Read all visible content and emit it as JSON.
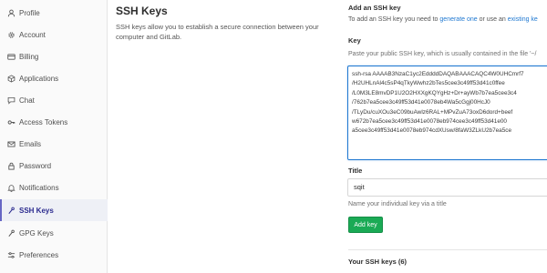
{
  "sidebar": {
    "items": [
      {
        "label": "Profile",
        "icon": "user-icon"
      },
      {
        "label": "Account",
        "icon": "gear-icon"
      },
      {
        "label": "Billing",
        "icon": "credit-card-icon"
      },
      {
        "label": "Applications",
        "icon": "cube-icon"
      },
      {
        "label": "Chat",
        "icon": "comment-icon"
      },
      {
        "label": "Access Tokens",
        "icon": "key-icon"
      },
      {
        "label": "Emails",
        "icon": "envelope-icon"
      },
      {
        "label": "Password",
        "icon": "lock-icon"
      },
      {
        "label": "Notifications",
        "icon": "bell-icon"
      },
      {
        "label": "SSH Keys",
        "icon": "key-icon",
        "active": true
      },
      {
        "label": "GPG Keys",
        "icon": "key-icon"
      },
      {
        "label": "Preferences",
        "icon": "sliders-icon"
      }
    ]
  },
  "intro": {
    "title": "SSH Keys",
    "description": "SSH keys allow you to establish a secure connection between your computer and GitLab."
  },
  "form": {
    "heading": "Add an SSH key",
    "hint_prefix": "To add an SSH key you need to ",
    "hint_link1": "generate one",
    "hint_middle": " or use an ",
    "hint_link2": "existing ke",
    "key_label": "Key",
    "key_hint": "Paste your public SSH key, which is usually contained in the file '~/",
    "key_value_lines": [
      "ssh-rsa AAAAB3NzaC1yc2EddddDAQABAAACAQC4W0UHCmrf7",
      "/H2UHLnAl4c5sP4qTkyWwhz2bTes5cee3c49ff53d41c0ffee",
      "/L0M3LE8mvDP1U2O2HXXgKQYgHz+Dr+ayWb7b7ea5cee3c4",
      "/762b7ea5cee3c49ff53d41e0078eb4Wa5cGgj00HcJ0",
      "/TLyDu/cuXOu3eC09buAwlz6RAL+MPvZuA73oxD6dord+beef",
      "w672b7ea5cee3c49ff53d41e0078eb974cee3c49ff53d41e00",
      "a5cee3c49ff53d41e0078eb974cdXUsw/8faW3ZLkU2b7ea5ce"
    ],
    "title_label": "Title",
    "title_value": "sqit",
    "title_hint": "Name your individual key via a title",
    "submit_label": "Add key",
    "your_keys_heading": "Your SSH keys (6)"
  },
  "colors": {
    "accent": "#1f78d1",
    "success": "#1aaa55",
    "active_nav": "#2b2b8f"
  }
}
